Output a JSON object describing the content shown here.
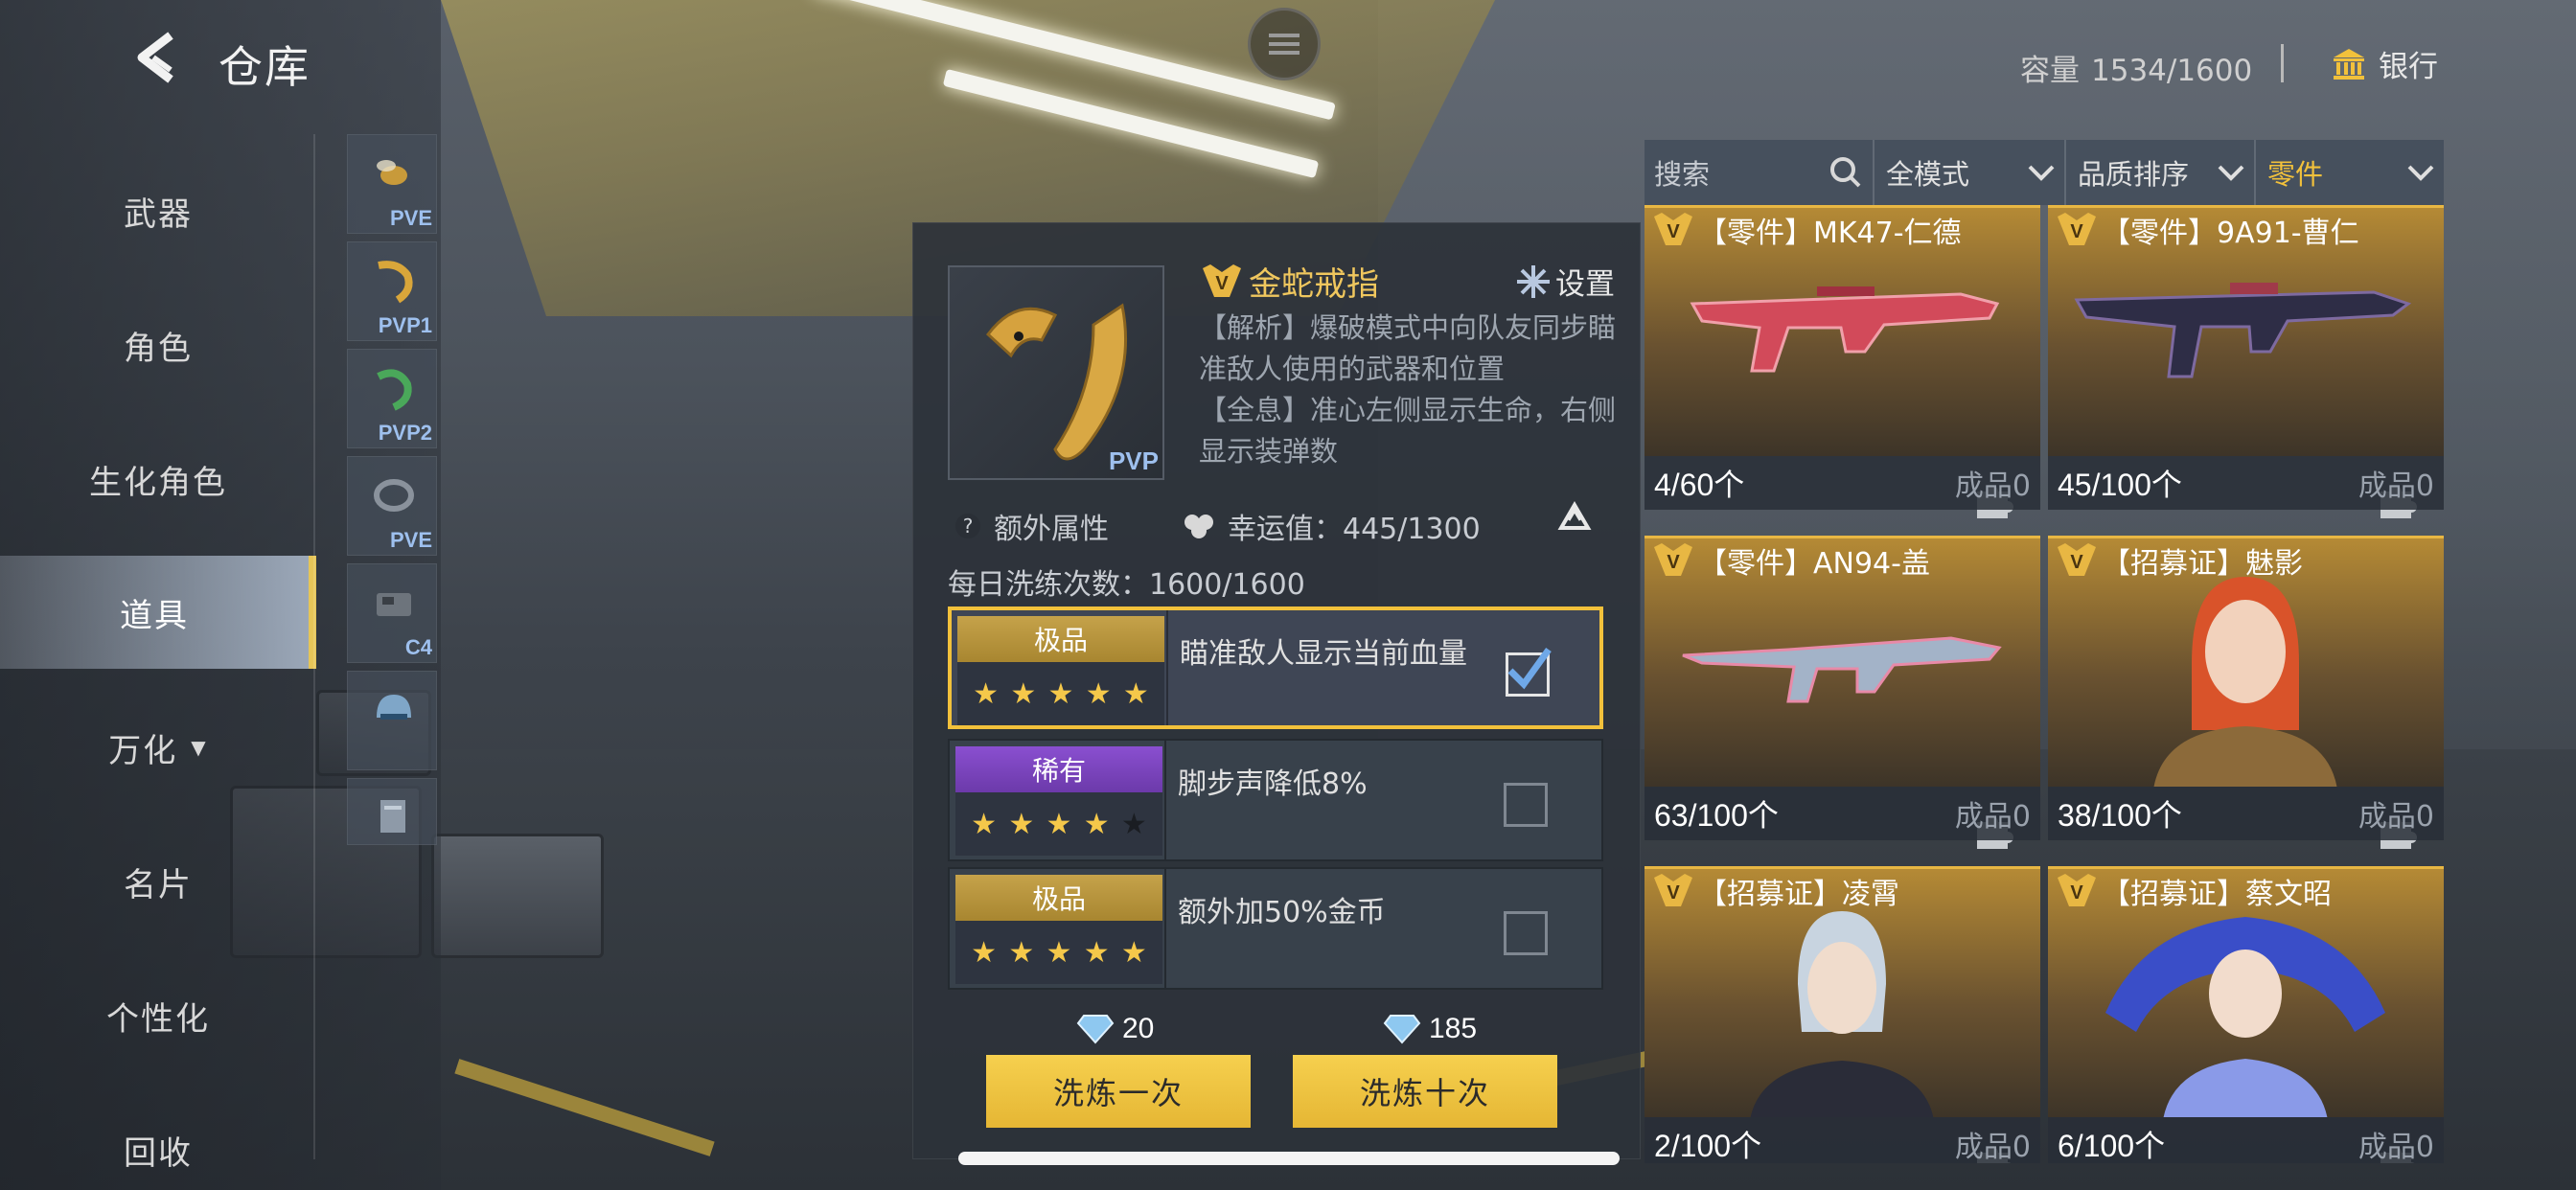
{
  "header": {
    "title": "仓库"
  },
  "nav": {
    "items": [
      {
        "label": "武器"
      },
      {
        "label": "角色"
      },
      {
        "label": "生化角色"
      },
      {
        "label": "道具"
      },
      {
        "label": "万化"
      },
      {
        "label": "名片"
      },
      {
        "label": "个性化"
      },
      {
        "label": "回收"
      }
    ],
    "active": "道具"
  },
  "subnav": [
    "PVE",
    "PVP1",
    "PVP2",
    "PVE",
    "C4",
    "",
    ""
  ],
  "topbar": {
    "capacity_label": "容量",
    "capacity_value": "1534/1600",
    "bank_label": "银行"
  },
  "filters": {
    "search_placeholder": "搜索",
    "mode": "全模式",
    "sort": "品质排序",
    "category": "零件"
  },
  "items": [
    {
      "name": "【零件】MK47-仁德",
      "count": "4/60个",
      "made": "成品0",
      "kind": "gun-red"
    },
    {
      "name": "【零件】9A91-曹仁",
      "count": "45/100个",
      "made": "成品0",
      "kind": "gun-dark"
    },
    {
      "name": "【零件】AN94-盖",
      "count": "63/100个",
      "made": "成品0",
      "kind": "gun-pink"
    },
    {
      "name": "【招募证】魅影",
      "count": "38/100个",
      "made": "成品0",
      "kind": "char-red"
    },
    {
      "name": "【招募证】凌霄",
      "count": "2/100个",
      "made": "成品0",
      "kind": "char-white"
    },
    {
      "name": "【招募证】蔡文昭",
      "count": "6/100个",
      "made": "成品0",
      "kind": "char-blue"
    }
  ],
  "detail": {
    "name": "金蛇戒指",
    "thumb_tag": "PVP",
    "settings_label": "设置",
    "desc1": "【解析】爆破模式中向队友同步瞄准敌人使用的武器和位置",
    "desc2": "【全息】准心左侧显示生命，右侧显示装弹数",
    "extra_label": "额外属性",
    "luck_label": "幸运值：445/1300",
    "daily_label": "每日洗练次数：1600/1600",
    "attributes": [
      {
        "grade": "极品",
        "stars": 5,
        "text": "瞄准敌人显示当前血量",
        "checked": true
      },
      {
        "grade": "稀有",
        "stars": 4,
        "text": "脚步声降低8%",
        "checked": false
      },
      {
        "grade": "极品",
        "stars": 5,
        "text": "额外加50%金币",
        "checked": false
      }
    ],
    "cost_once": "20",
    "cost_ten": "185",
    "btn_once": "洗炼一次",
    "btn_ten": "洗炼十次"
  },
  "colors": {
    "accent_gold": "#f2c13b",
    "rare_purple": "#8a4fd0",
    "epic_gold": "#c5a24a"
  }
}
